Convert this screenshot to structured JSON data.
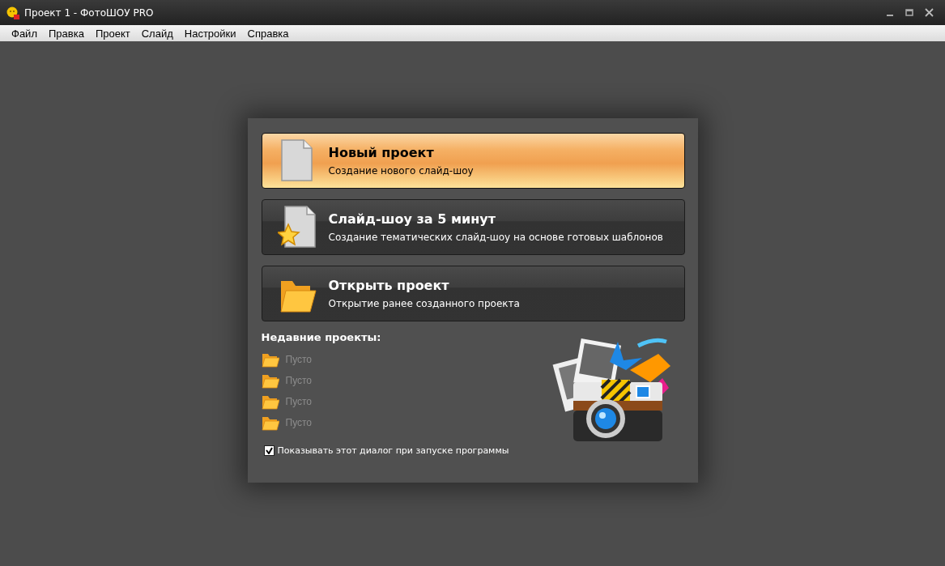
{
  "window": {
    "title": "Проект 1 - ФотоШОУ PRO"
  },
  "menu": [
    "Файл",
    "Правка",
    "Проект",
    "Слайд",
    "Настройки",
    "Справка"
  ],
  "actions": [
    {
      "kind": "new",
      "title": "Новый проект",
      "subtitle": "Создание нового слайд-шоу",
      "selected": true
    },
    {
      "kind": "template",
      "title": "Слайд-шоу за 5 минут",
      "subtitle": "Создание тематических слайд-шоу на основе готовых шаблонов",
      "selected": false
    },
    {
      "kind": "open",
      "title": "Открыть проект",
      "subtitle": "Открытие ранее созданного проекта",
      "selected": false
    }
  ],
  "recent": {
    "heading": "Недавние проекты:",
    "items": [
      {
        "label": "Пусто",
        "disabled": true
      },
      {
        "label": "Пусто",
        "disabled": true
      },
      {
        "label": "Пусто",
        "disabled": true
      },
      {
        "label": "Пусто",
        "disabled": true
      }
    ]
  },
  "show_on_startup": {
    "label": "Показывать этот диалог при запуске программы",
    "checked": true
  }
}
